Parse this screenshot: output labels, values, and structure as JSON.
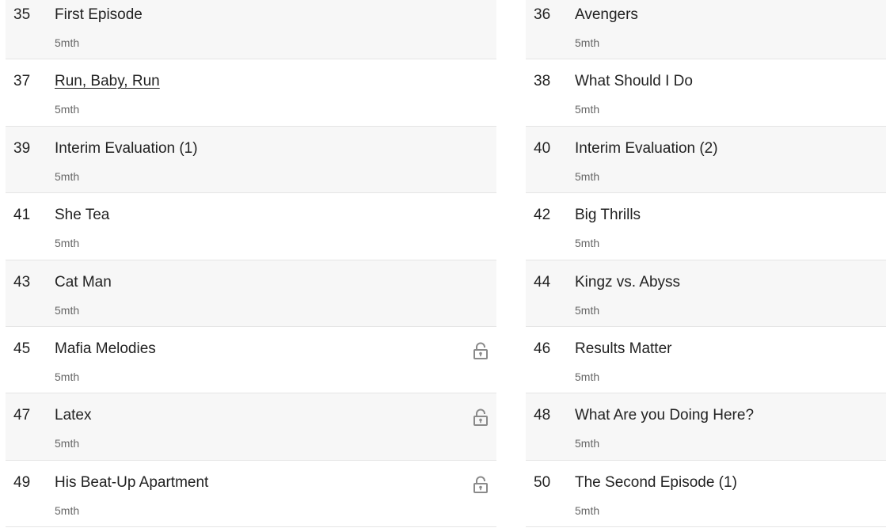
{
  "colors": {
    "text": "#222222",
    "meta": "#666666",
    "row_shade": "#f7f7f7",
    "divider": "#e5e5e5",
    "lock_icon": "#8a8a8a"
  },
  "left_episodes": [
    {
      "number": "35",
      "title": "First Episode",
      "meta": "5mth",
      "locked": false,
      "link": false
    },
    {
      "number": "37",
      "title": "Run, Baby, Run",
      "meta": "5mth",
      "locked": false,
      "link": true
    },
    {
      "number": "39",
      "title": "Interim Evaluation (1)",
      "meta": "5mth",
      "locked": false,
      "link": false
    },
    {
      "number": "41",
      "title": "She Tea",
      "meta": "5mth",
      "locked": false,
      "link": false
    },
    {
      "number": "43",
      "title": "Cat Man",
      "meta": "5mth",
      "locked": false,
      "link": false
    },
    {
      "number": "45",
      "title": "Mafia Melodies",
      "meta": "5mth",
      "locked": true,
      "link": false
    },
    {
      "number": "47",
      "title": "Latex",
      "meta": "5mth",
      "locked": true,
      "link": false
    },
    {
      "number": "49",
      "title": "His Beat-Up Apartment",
      "meta": "5mth",
      "locked": true,
      "link": false
    }
  ],
  "right_episodes": [
    {
      "number": "36",
      "title": "Avengers",
      "meta": "5mth",
      "locked": false,
      "link": false
    },
    {
      "number": "38",
      "title": "What Should I Do",
      "meta": "5mth",
      "locked": false,
      "link": false
    },
    {
      "number": "40",
      "title": "Interim Evaluation (2)",
      "meta": "5mth",
      "locked": false,
      "link": false
    },
    {
      "number": "42",
      "title": "Big Thrills",
      "meta": "5mth",
      "locked": false,
      "link": false
    },
    {
      "number": "44",
      "title": "Kingz vs. Abyss",
      "meta": "5mth",
      "locked": false,
      "link": false
    },
    {
      "number": "46",
      "title": "Results Matter",
      "meta": "5mth",
      "locked": false,
      "link": false
    },
    {
      "number": "48",
      "title": "What Are you Doing Here?",
      "meta": "5mth",
      "locked": false,
      "link": false
    },
    {
      "number": "50",
      "title": "The Second Episode (1)",
      "meta": "5mth",
      "locked": false,
      "link": false
    }
  ]
}
